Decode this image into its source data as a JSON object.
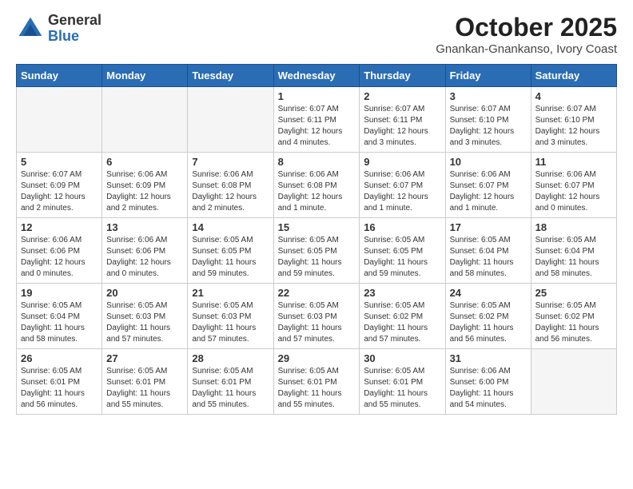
{
  "logo": {
    "general": "General",
    "blue": "Blue"
  },
  "title": {
    "month": "October 2025",
    "location": "Gnankan-Gnankanso, Ivory Coast"
  },
  "weekdays": [
    "Sunday",
    "Monday",
    "Tuesday",
    "Wednesday",
    "Thursday",
    "Friday",
    "Saturday"
  ],
  "weeks": [
    [
      {
        "day": "",
        "info": ""
      },
      {
        "day": "",
        "info": ""
      },
      {
        "day": "",
        "info": ""
      },
      {
        "day": "1",
        "info": "Sunrise: 6:07 AM\nSunset: 6:11 PM\nDaylight: 12 hours and 4 minutes."
      },
      {
        "day": "2",
        "info": "Sunrise: 6:07 AM\nSunset: 6:11 PM\nDaylight: 12 hours and 3 minutes."
      },
      {
        "day": "3",
        "info": "Sunrise: 6:07 AM\nSunset: 6:10 PM\nDaylight: 12 hours and 3 minutes."
      },
      {
        "day": "4",
        "info": "Sunrise: 6:07 AM\nSunset: 6:10 PM\nDaylight: 12 hours and 3 minutes."
      }
    ],
    [
      {
        "day": "5",
        "info": "Sunrise: 6:07 AM\nSunset: 6:09 PM\nDaylight: 12 hours and 2 minutes."
      },
      {
        "day": "6",
        "info": "Sunrise: 6:06 AM\nSunset: 6:09 PM\nDaylight: 12 hours and 2 minutes."
      },
      {
        "day": "7",
        "info": "Sunrise: 6:06 AM\nSunset: 6:08 PM\nDaylight: 12 hours and 2 minutes."
      },
      {
        "day": "8",
        "info": "Sunrise: 6:06 AM\nSunset: 6:08 PM\nDaylight: 12 hours and 1 minute."
      },
      {
        "day": "9",
        "info": "Sunrise: 6:06 AM\nSunset: 6:07 PM\nDaylight: 12 hours and 1 minute."
      },
      {
        "day": "10",
        "info": "Sunrise: 6:06 AM\nSunset: 6:07 PM\nDaylight: 12 hours and 1 minute."
      },
      {
        "day": "11",
        "info": "Sunrise: 6:06 AM\nSunset: 6:07 PM\nDaylight: 12 hours and 0 minutes."
      }
    ],
    [
      {
        "day": "12",
        "info": "Sunrise: 6:06 AM\nSunset: 6:06 PM\nDaylight: 12 hours and 0 minutes."
      },
      {
        "day": "13",
        "info": "Sunrise: 6:06 AM\nSunset: 6:06 PM\nDaylight: 12 hours and 0 minutes."
      },
      {
        "day": "14",
        "info": "Sunrise: 6:05 AM\nSunset: 6:05 PM\nDaylight: 11 hours and 59 minutes."
      },
      {
        "day": "15",
        "info": "Sunrise: 6:05 AM\nSunset: 6:05 PM\nDaylight: 11 hours and 59 minutes."
      },
      {
        "day": "16",
        "info": "Sunrise: 6:05 AM\nSunset: 6:05 PM\nDaylight: 11 hours and 59 minutes."
      },
      {
        "day": "17",
        "info": "Sunrise: 6:05 AM\nSunset: 6:04 PM\nDaylight: 11 hours and 58 minutes."
      },
      {
        "day": "18",
        "info": "Sunrise: 6:05 AM\nSunset: 6:04 PM\nDaylight: 11 hours and 58 minutes."
      }
    ],
    [
      {
        "day": "19",
        "info": "Sunrise: 6:05 AM\nSunset: 6:04 PM\nDaylight: 11 hours and 58 minutes."
      },
      {
        "day": "20",
        "info": "Sunrise: 6:05 AM\nSunset: 6:03 PM\nDaylight: 11 hours and 57 minutes."
      },
      {
        "day": "21",
        "info": "Sunrise: 6:05 AM\nSunset: 6:03 PM\nDaylight: 11 hours and 57 minutes."
      },
      {
        "day": "22",
        "info": "Sunrise: 6:05 AM\nSunset: 6:03 PM\nDaylight: 11 hours and 57 minutes."
      },
      {
        "day": "23",
        "info": "Sunrise: 6:05 AM\nSunset: 6:02 PM\nDaylight: 11 hours and 57 minutes."
      },
      {
        "day": "24",
        "info": "Sunrise: 6:05 AM\nSunset: 6:02 PM\nDaylight: 11 hours and 56 minutes."
      },
      {
        "day": "25",
        "info": "Sunrise: 6:05 AM\nSunset: 6:02 PM\nDaylight: 11 hours and 56 minutes."
      }
    ],
    [
      {
        "day": "26",
        "info": "Sunrise: 6:05 AM\nSunset: 6:01 PM\nDaylight: 11 hours and 56 minutes."
      },
      {
        "day": "27",
        "info": "Sunrise: 6:05 AM\nSunset: 6:01 PM\nDaylight: 11 hours and 55 minutes."
      },
      {
        "day": "28",
        "info": "Sunrise: 6:05 AM\nSunset: 6:01 PM\nDaylight: 11 hours and 55 minutes."
      },
      {
        "day": "29",
        "info": "Sunrise: 6:05 AM\nSunset: 6:01 PM\nDaylight: 11 hours and 55 minutes."
      },
      {
        "day": "30",
        "info": "Sunrise: 6:05 AM\nSunset: 6:01 PM\nDaylight: 11 hours and 55 minutes."
      },
      {
        "day": "31",
        "info": "Sunrise: 6:06 AM\nSunset: 6:00 PM\nDaylight: 11 hours and 54 minutes."
      },
      {
        "day": "",
        "info": ""
      }
    ]
  ]
}
